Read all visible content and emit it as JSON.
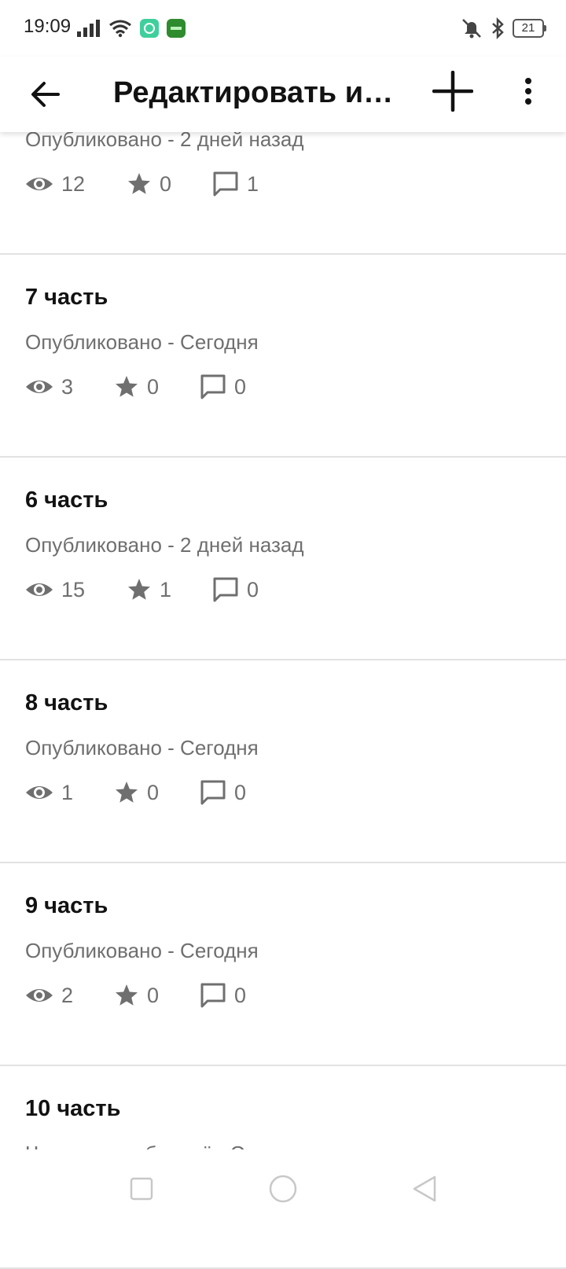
{
  "status_bar": {
    "time": "19:09",
    "battery": "21"
  },
  "toolbar": {
    "title": "Редактировать и…"
  },
  "chapters": [
    {
      "title": "",
      "status": "Опубликовано - 2 дней назад",
      "views": "12",
      "votes": "0",
      "comments": "1"
    },
    {
      "title": "7 часть",
      "status": "Опубликовано - Сегодня",
      "views": "3",
      "votes": "0",
      "comments": "0"
    },
    {
      "title": "6 часть",
      "status": "Опубликовано - 2 дней назад",
      "views": "15",
      "votes": "1",
      "comments": "0"
    },
    {
      "title": "8 часть",
      "status": "Опубликовано - Сегодня",
      "views": "1",
      "votes": "0",
      "comments": "0"
    },
    {
      "title": "9 часть",
      "status": "Опубликовано - Сегодня",
      "views": "2",
      "votes": "0",
      "comments": "0"
    },
    {
      "title": "10 часть",
      "status": "Черновик - обновлён Сегодня",
      "views": "",
      "votes": "",
      "comments": ""
    }
  ],
  "icons": {
    "back": "arrow-back-icon",
    "add": "plus-icon",
    "more": "more-vertical-icon",
    "views": "eye-icon",
    "votes": "star-icon",
    "comments": "comment-icon"
  },
  "colors": {
    "text": "#121212",
    "secondary": "#6f6f6f",
    "divider": "#e2e2e2"
  }
}
